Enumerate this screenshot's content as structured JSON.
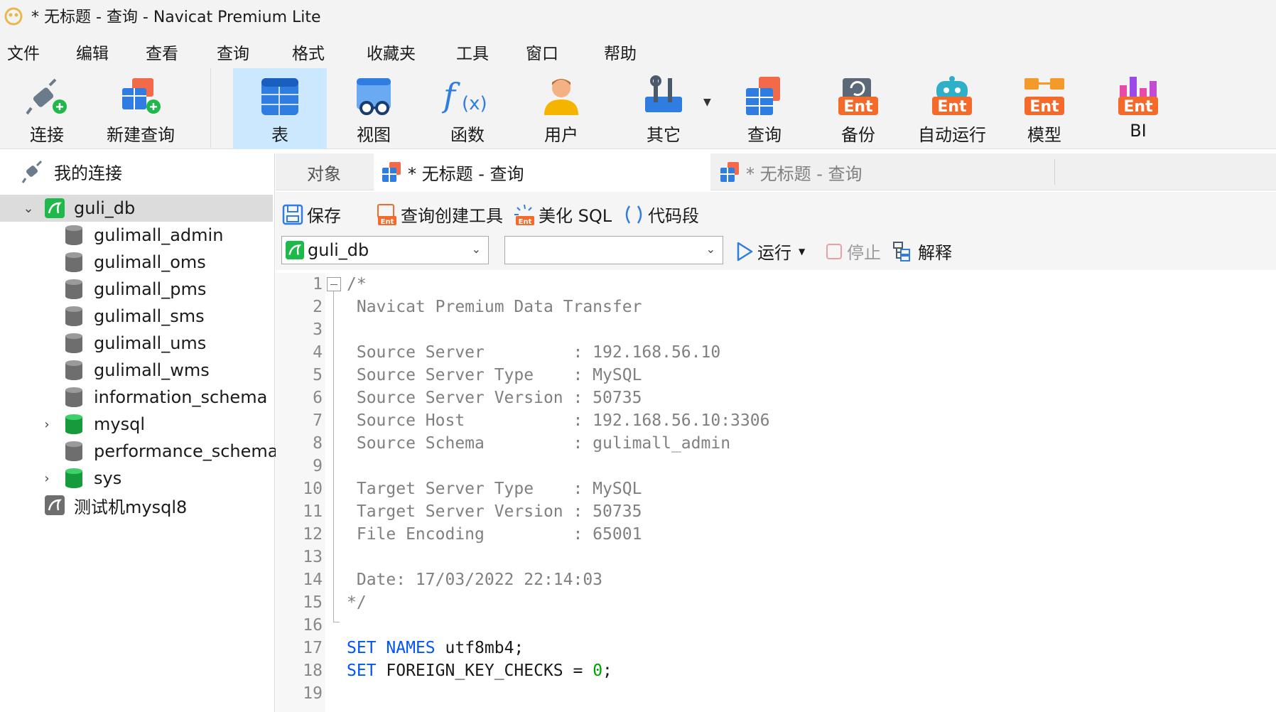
{
  "window": {
    "title": "* 无标题 - 查询 - Navicat Premium Lite"
  },
  "menu": [
    "文件",
    "编辑",
    "查看",
    "查询",
    "格式",
    "收藏夹",
    "工具",
    "窗口",
    "帮助"
  ],
  "toolbar": {
    "connect": "连接",
    "new_query": "新建查询",
    "table": "表",
    "view": "视图",
    "function": "函数",
    "user": "用户",
    "other": "其它",
    "query": "查询",
    "backup": "备份",
    "automation": "自动运行",
    "model": "模型",
    "bi": "BI",
    "ent_badge": "Ent"
  },
  "sidebar": {
    "header": "我的连接",
    "connection": "guli_db",
    "databases": [
      "gulimall_admin",
      "gulimall_oms",
      "gulimall_pms",
      "gulimall_sms",
      "gulimall_ums",
      "gulimall_wms",
      "information_schema",
      "mysql",
      "performance_schema",
      "sys"
    ],
    "other_connection": "测试机mysql8"
  },
  "tabs": {
    "objects": "对象",
    "active_tab": "* 无标题 - 查询",
    "inactive_tab": "* 无标题 - 查询"
  },
  "editor_toolbar": {
    "save": "保存",
    "query_builder": "查询创建工具",
    "beautify": "美化 SQL",
    "snippet": "代码段",
    "db_select": "guli_db",
    "schema_select": "",
    "run": "运行",
    "stop": "停止",
    "explain": "解释"
  },
  "code": {
    "lines": [
      "/*",
      " Navicat Premium Data Transfer",
      "",
      " Source Server         : 192.168.56.10",
      " Source Server Type    : MySQL",
      " Source Server Version : 50735",
      " Source Host           : 192.168.56.10:3306",
      " Source Schema         : gulimall_admin",
      "",
      " Target Server Type    : MySQL",
      " Target Server Version : 50735",
      " File Encoding         : 65001",
      "",
      " Date: 17/03/2022 22:14:03",
      "*/",
      ""
    ],
    "line17": {
      "kw1": "SET",
      "kw2": "NAMES",
      "rest": " utf8mb4;"
    },
    "line18": {
      "kw1": "SET",
      "rest": " FOREIGN_KEY_CHECKS = ",
      "num": "0",
      "end": ";"
    },
    "line_numbers": [
      "1",
      "2",
      "3",
      "4",
      "5",
      "6",
      "7",
      "8",
      "9",
      "10",
      "11",
      "12",
      "13",
      "14",
      "15",
      "16",
      "17",
      "18",
      "19"
    ]
  },
  "colors": {
    "accent": "#cce8ff",
    "keyword": "#0055ff",
    "comment": "#808080",
    "number": "#00a000"
  }
}
